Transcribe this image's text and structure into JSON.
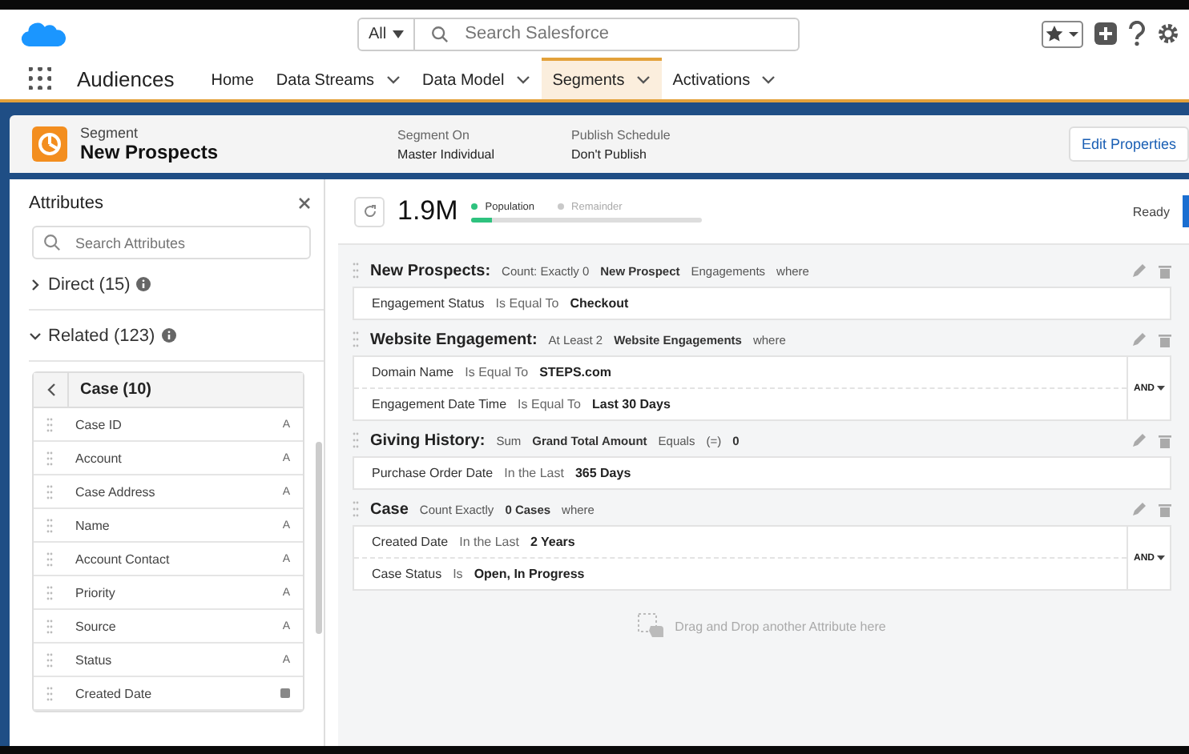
{
  "header": {
    "search_scope": "All",
    "search_placeholder": "Search Salesforce"
  },
  "nav": {
    "app_name": "Audiences",
    "tabs": [
      {
        "label": "Home",
        "dropdown": false,
        "selected": false
      },
      {
        "label": "Data Streams",
        "dropdown": true,
        "selected": false
      },
      {
        "label": "Data Model",
        "dropdown": true,
        "selected": false
      },
      {
        "label": "Segments",
        "dropdown": true,
        "selected": true
      },
      {
        "label": "Activations",
        "dropdown": true,
        "selected": false
      }
    ]
  },
  "record": {
    "type_label": "Segment",
    "name": "New Prospects",
    "fields": [
      {
        "label": "Segment On",
        "value": "Master Individual"
      },
      {
        "label": "Publish Schedule",
        "value": "Don't Publish"
      }
    ],
    "action": "Edit Properties"
  },
  "attributes": {
    "title": "Attributes",
    "search_placeholder": "Search Attributes",
    "sections": [
      {
        "label": "Direct (15)",
        "expanded": false
      },
      {
        "label": "Related (123)",
        "expanded": true
      }
    ],
    "object_title": "Case (10)",
    "items": [
      {
        "name": "Case ID",
        "kind": "text",
        "type_glyph": "A"
      },
      {
        "name": "Account",
        "kind": "text",
        "type_glyph": "A"
      },
      {
        "name": "Case Address",
        "kind": "text",
        "type_glyph": "A"
      },
      {
        "name": "Name",
        "kind": "text",
        "type_glyph": "A"
      },
      {
        "name": "Account Contact",
        "kind": "text",
        "type_glyph": "A"
      },
      {
        "name": "Priority",
        "kind": "text",
        "type_glyph": "A"
      },
      {
        "name": "Source",
        "kind": "text",
        "type_glyph": "A"
      },
      {
        "name": "Status",
        "kind": "text",
        "type_glyph": "A"
      },
      {
        "name": "Created Date",
        "kind": "date"
      }
    ]
  },
  "summary": {
    "count": "1.9M",
    "legend": [
      {
        "label": "Population",
        "color": "#2ec27e"
      },
      {
        "label": "Remainder",
        "color": "#c9c9c9"
      }
    ],
    "level": 0.09,
    "status": "Ready"
  },
  "groups": [
    {
      "title": "New Prospects:",
      "phrase": [
        {
          "text": "Count: Exactly 0",
          "bold": false
        },
        {
          "text": "New Prospect",
          "bold": true
        },
        {
          "text": "Engagements",
          "bold": false
        },
        {
          "text": "where",
          "bold": false
        }
      ],
      "rows": [
        {
          "field": "Engagement Status",
          "operator": "Is Equal To",
          "value": "Checkout"
        }
      ]
    },
    {
      "title": "Website Engagement:",
      "phrase": [
        {
          "text": "At Least 2",
          "bold": false
        },
        {
          "text": "Website Engagements",
          "bold": true
        },
        {
          "text": "where",
          "bold": false
        }
      ],
      "logic": "AND",
      "rows": [
        {
          "field": "Domain Name",
          "operator": "Is Equal To",
          "value": "STEPS.com"
        },
        {
          "field": "Engagement Date Time",
          "operator": "Is Equal To",
          "value": "Last 30 Days"
        }
      ]
    },
    {
      "title": "Giving History:",
      "phrase": [
        {
          "text": "Sum",
          "bold": false
        },
        {
          "text": "Grand Total Amount",
          "bold": true
        },
        {
          "text": "Equals",
          "bold": false
        },
        {
          "text": "(=)",
          "bold": false
        },
        {
          "text": "0",
          "bold": true
        }
      ],
      "rows": [
        {
          "field": "Purchase Order Date",
          "operator": "In the Last",
          "value": "365 Days"
        }
      ]
    },
    {
      "title": "Case",
      "phrase": [
        {
          "text": "Count Exactly",
          "bold": false
        },
        {
          "text": "0 Cases",
          "bold": true
        },
        {
          "text": "where",
          "bold": false
        }
      ],
      "logic": "AND",
      "rows": [
        {
          "field": "Created Date",
          "operator": "In the Last",
          "value": "2 Years"
        },
        {
          "field": "Case Status",
          "operator": "Is",
          "value": "Open, In Progress"
        }
      ]
    }
  ],
  "drop_hint": "Drag and Drop another Attribute here"
}
